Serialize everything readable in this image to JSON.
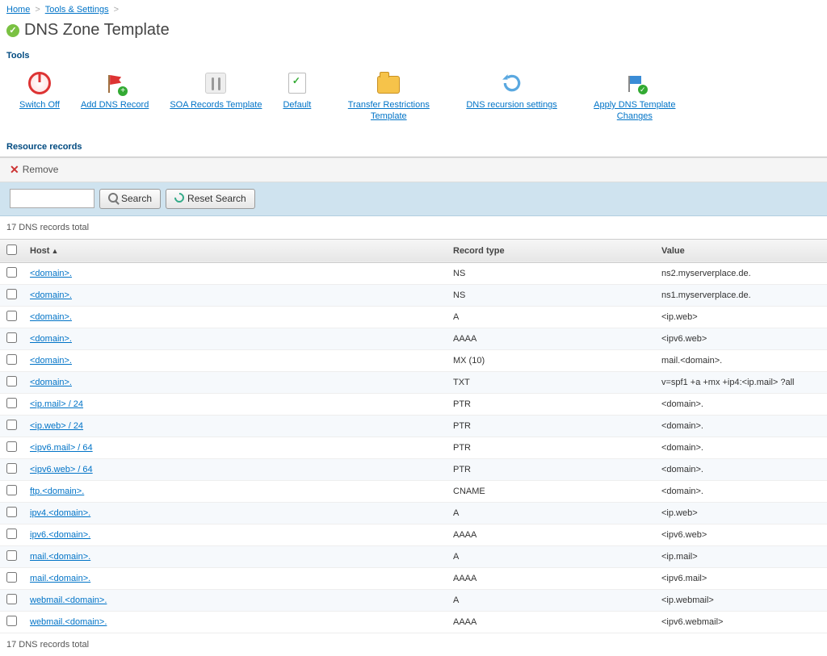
{
  "breadcrumb": {
    "home": "Home",
    "tools": "Tools & Settings"
  },
  "page_title": "DNS Zone Template",
  "sections": {
    "tools": "Tools",
    "resources": "Resource records"
  },
  "tools": {
    "switch_off": "Switch Off",
    "add_record": "Add DNS Record",
    "soa": "SOA Records Template",
    "default": "Default",
    "transfer": "Transfer Restrictions Template",
    "recursion": "DNS recursion settings",
    "apply": "Apply DNS Template Changes"
  },
  "remove_label": "Remove",
  "search": {
    "placeholder": "",
    "search_btn": "Search",
    "reset_btn": "Reset Search"
  },
  "count_text": "17 DNS records total",
  "columns": {
    "host": "Host",
    "type": "Record type",
    "value": "Value"
  },
  "records": [
    {
      "host": "<domain>.",
      "type": "NS",
      "value": "ns2.myserverplace.de."
    },
    {
      "host": "<domain>.",
      "type": "NS",
      "value": "ns1.myserverplace.de."
    },
    {
      "host": "<domain>.",
      "type": "A",
      "value": "<ip.web>"
    },
    {
      "host": "<domain>.",
      "type": "AAAA",
      "value": "<ipv6.web>"
    },
    {
      "host": "<domain>.",
      "type": "MX (10)",
      "value": "mail.<domain>."
    },
    {
      "host": "<domain>.",
      "type": "TXT",
      "value": "v=spf1 +a +mx +ip4:<ip.mail> ?all"
    },
    {
      "host": "<ip.mail> / 24",
      "type": "PTR",
      "value": "<domain>."
    },
    {
      "host": "<ip.web> / 24",
      "type": "PTR",
      "value": "<domain>."
    },
    {
      "host": "<ipv6.mail> / 64",
      "type": "PTR",
      "value": "<domain>."
    },
    {
      "host": "<ipv6.web> / 64",
      "type": "PTR",
      "value": "<domain>."
    },
    {
      "host": "ftp.<domain>.",
      "type": "CNAME",
      "value": "<domain>."
    },
    {
      "host": "ipv4.<domain>.",
      "type": "A",
      "value": "<ip.web>"
    },
    {
      "host": "ipv6.<domain>.",
      "type": "AAAA",
      "value": "<ipv6.web>"
    },
    {
      "host": "mail.<domain>.",
      "type": "A",
      "value": "<ip.mail>"
    },
    {
      "host": "mail.<domain>.",
      "type": "AAAA",
      "value": "<ipv6.mail>"
    },
    {
      "host": "webmail.<domain>.",
      "type": "A",
      "value": "<ip.webmail>"
    },
    {
      "host": "webmail.<domain>.",
      "type": "AAAA",
      "value": "<ipv6.webmail>"
    }
  ]
}
